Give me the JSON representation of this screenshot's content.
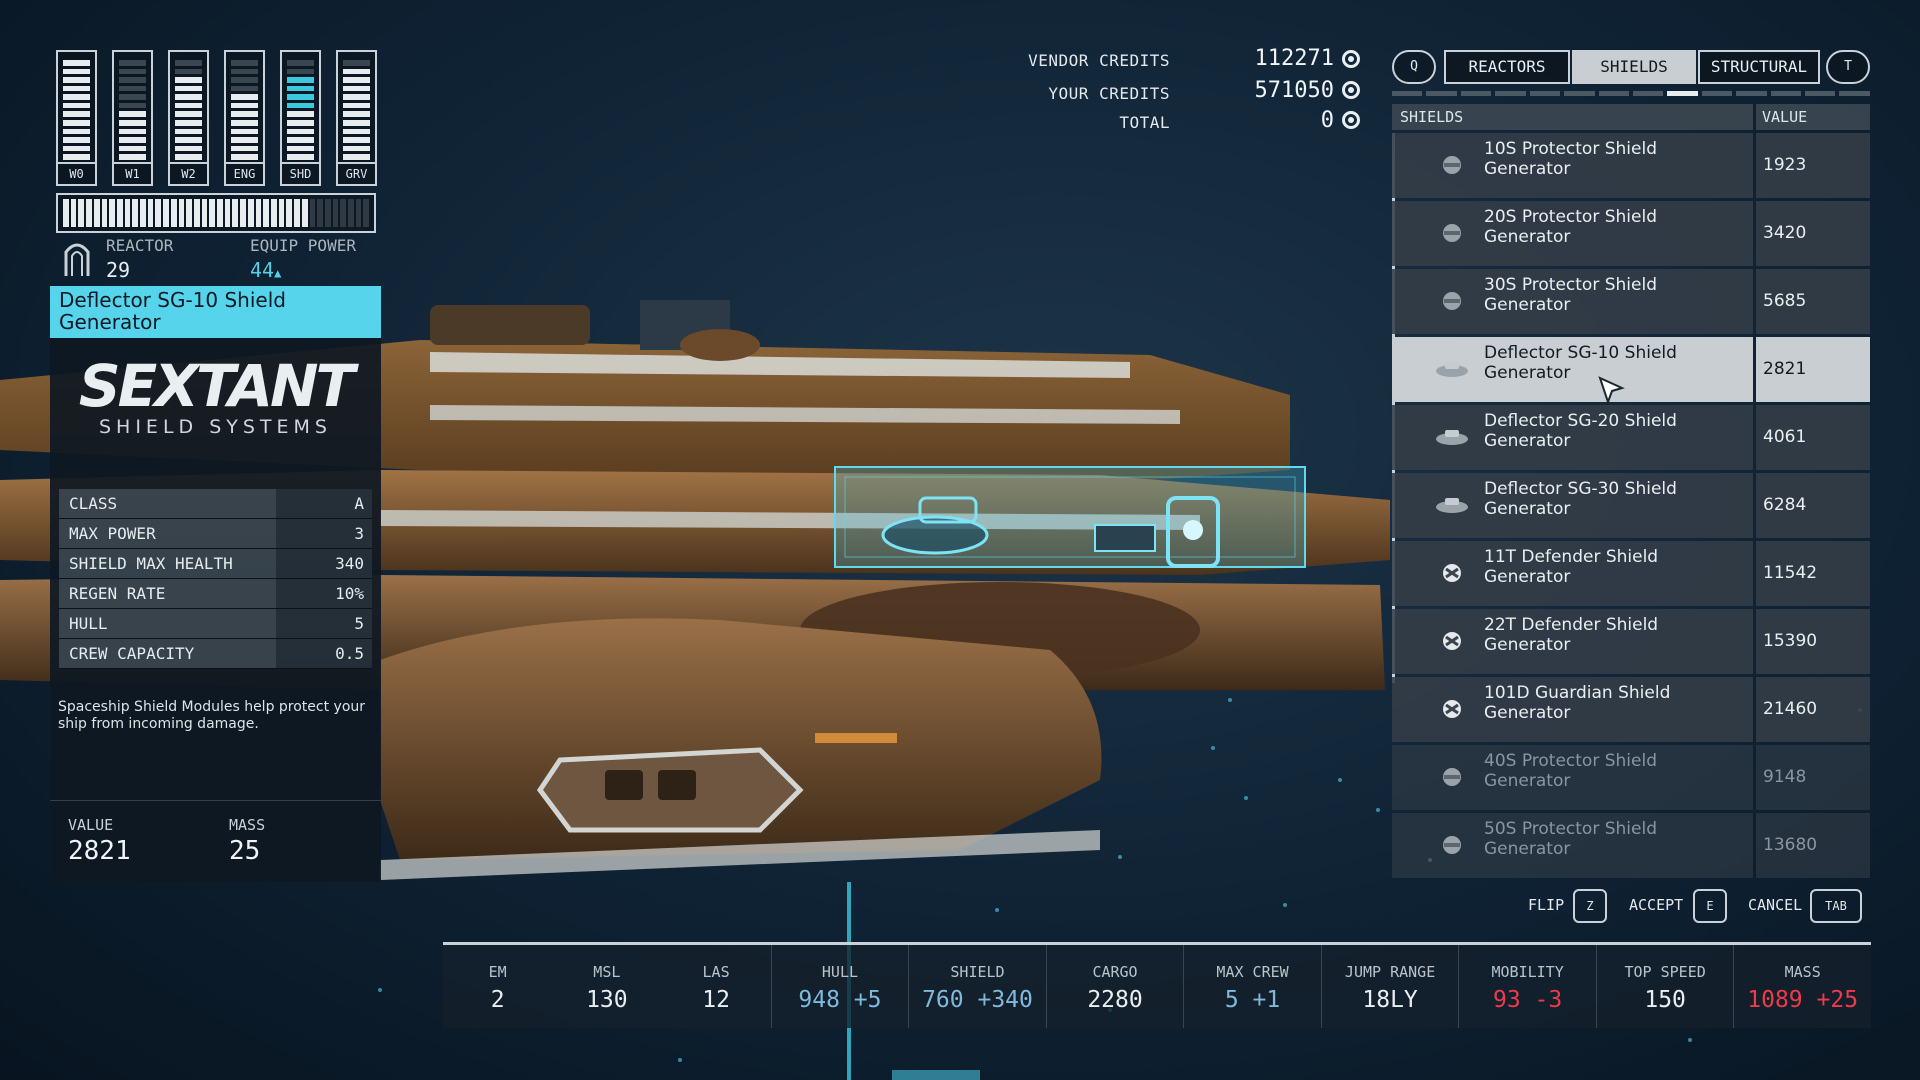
{
  "power": {
    "bars": [
      {
        "label": "W0",
        "level": 1.0,
        "color": "#e7ecef"
      },
      {
        "label": "W1",
        "level": 0.5,
        "color": "#e7ecef"
      },
      {
        "label": "W2",
        "level": 0.83,
        "color": "#e7ecef"
      },
      {
        "label": "ENG",
        "level": 0.67,
        "color": "#e7ecef"
      },
      {
        "label": "SHD",
        "level": 0.83,
        "color": "#3bc7de"
      },
      {
        "label": "GRV",
        "level": 0.92,
        "color": "#e7ecef"
      }
    ],
    "reactor_fill": 0.8,
    "reactor_label": "REACTOR",
    "reactor_value": "29",
    "equip_label": "EQUIP POWER",
    "equip_value": "44",
    "equip_arrow": "▲"
  },
  "details": {
    "title": "Deflector SG-10 Shield Generator",
    "brand_main": "SEXTANT",
    "brand_sub": "SHIELD SYSTEMS",
    "stats": [
      {
        "label": "CLASS",
        "value": "A"
      },
      {
        "label": "MAX POWER",
        "value": "3"
      },
      {
        "label": "SHIELD MAX HEALTH",
        "value": "340"
      },
      {
        "label": "REGEN RATE",
        "value": "10%"
      },
      {
        "label": "HULL",
        "value": "5"
      },
      {
        "label": "CREW CAPACITY",
        "value": "0.5"
      }
    ],
    "description": "Spaceship Shield Modules help protect your ship from incoming damage.",
    "value_label": "VALUE",
    "value": "2821",
    "mass_label": "MASS",
    "mass": "25"
  },
  "credits": {
    "vendor_label": "VENDOR CREDITS",
    "vendor_value": "112271",
    "yours_label": "YOUR CREDITS",
    "yours_value": "571050",
    "total_label": "TOTAL",
    "total_value": "0"
  },
  "tabs": {
    "prev_key": "Q",
    "next_key": "T",
    "items": [
      "REACTORS",
      "SHIELDS",
      "STRUCTURAL"
    ],
    "active": "SHIELDS"
  },
  "list": {
    "header_name": "SHIELDS",
    "header_value": "VALUE",
    "rows": [
      {
        "name": "10S Protector Shield Generator",
        "value": "1923",
        "icon": "shield-round-icon",
        "state": "normal"
      },
      {
        "name": "20S Protector Shield Generator",
        "value": "3420",
        "icon": "shield-round-icon",
        "state": "normal"
      },
      {
        "name": "30S Protector Shield Generator",
        "value": "5685",
        "icon": "shield-round-icon",
        "state": "normal"
      },
      {
        "name": "Deflector SG-10 Shield Generator",
        "value": "2821",
        "icon": "shield-disc-icon",
        "state": "selected"
      },
      {
        "name": "Deflector SG-20 Shield Generator",
        "value": "4061",
        "icon": "shield-disc-icon",
        "state": "normal"
      },
      {
        "name": "Deflector SG-30 Shield Generator",
        "value": "6284",
        "icon": "shield-disc-icon",
        "state": "normal"
      },
      {
        "name": "11T Defender Shield Generator",
        "value": "11542",
        "icon": "shield-pod-icon",
        "state": "normal"
      },
      {
        "name": "22T Defender Shield Generator",
        "value": "15390",
        "icon": "shield-pod-icon",
        "state": "normal"
      },
      {
        "name": "101D Guardian Shield Generator",
        "value": "21460",
        "icon": "shield-pod-icon",
        "state": "normal"
      },
      {
        "name": "40S Protector Shield Generator",
        "value": "9148",
        "icon": "shield-round-icon",
        "state": "dim"
      },
      {
        "name": "50S Protector Shield Generator",
        "value": "13680",
        "icon": "shield-round-icon",
        "state": "dim"
      }
    ]
  },
  "actions": {
    "flip_label": "FLIP",
    "flip_key": "Z",
    "accept_label": "ACCEPT",
    "accept_key": "E",
    "cancel_label": "CANCEL",
    "cancel_key": "TAB"
  },
  "ship_stats": [
    {
      "label": "EM",
      "value": "2"
    },
    {
      "label": "MSL",
      "value": "130"
    },
    {
      "label": "LAS",
      "value": "12"
    },
    {
      "label": "HULL",
      "value": "948",
      "delta": "+5",
      "tone": "up"
    },
    {
      "label": "SHIELD",
      "value": "760",
      "delta": "+340",
      "tone": "up"
    },
    {
      "label": "CARGO",
      "value": "2280"
    },
    {
      "label": "MAX CREW",
      "value": "5",
      "delta": "+1",
      "tone": "up"
    },
    {
      "label": "JUMP RANGE",
      "value": "18LY"
    },
    {
      "label": "MOBILITY",
      "value": "93",
      "delta": "-3",
      "tone": "down"
    },
    {
      "label": "TOP SPEED",
      "value": "150"
    },
    {
      "label": "MASS",
      "value": "1089",
      "delta": "+25",
      "tone": "down"
    }
  ],
  "colors": {
    "accent": "#56d4ec",
    "negative": "#ef3a4a",
    "selected_row": "#c9ced2"
  }
}
